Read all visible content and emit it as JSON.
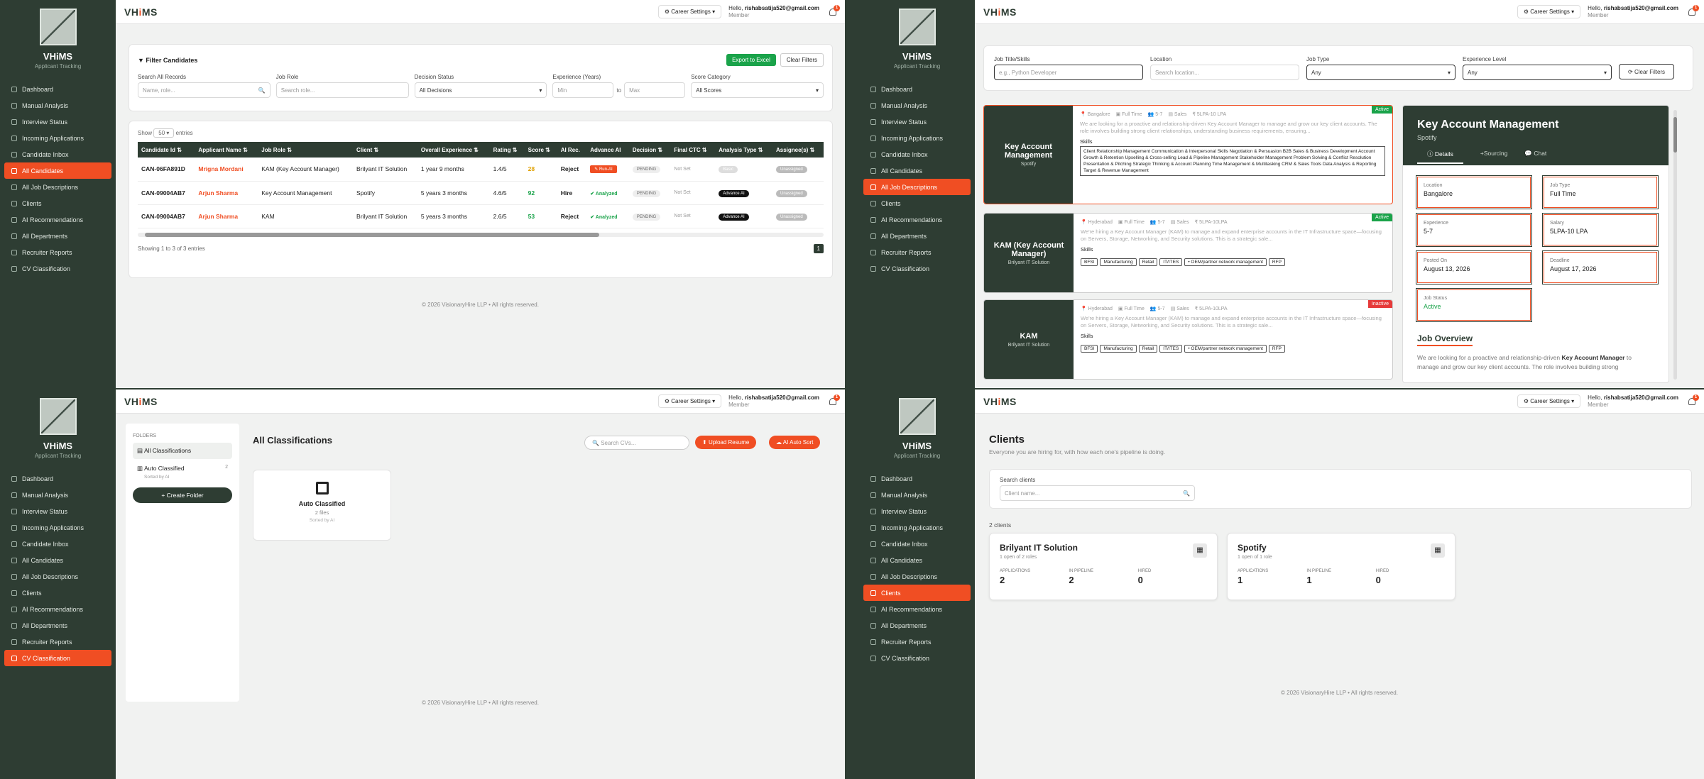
{
  "app": {
    "name": "VHiMS",
    "logo_prefix": "VH",
    "logo_accent": "i",
    "logo_suffix": "MS",
    "tagline": "Applicant Tracking",
    "career_settings": "Career Settings",
    "hello": "Hello,",
    "email": "rishabsatija520@gmail.com",
    "role": "Member",
    "notif_count": "1",
    "footer": "© 2026 VisionaryHire LLP • All rights reserved."
  },
  "nav": [
    "Dashboard",
    "Manual Analysis",
    "Interview Status",
    "Incoming Applications",
    "Candidate Inbox",
    "All Candidates",
    "All Job Descriptions",
    "Clients",
    "AI Recommendations",
    "All Departments",
    "Recruiter Reports",
    "CV Classification"
  ],
  "q1": {
    "filter_title": "Filter Candidates",
    "export": "Export to Excel",
    "clear": "Clear Filters",
    "labels": [
      "Search All Records",
      "Job Role",
      "Decision Status",
      "Experience (Years)",
      "Score Category"
    ],
    "ph": [
      "Name, role...",
      "Search role...",
      "All Decisions",
      "Min",
      "to",
      "Max",
      "All Scores"
    ],
    "show": "Show",
    "entries_val": "50",
    "entries": "entries",
    "headers": [
      "Candidate Id",
      "Applicant Name",
      "Job Role",
      "Client",
      "Overall Experience",
      "Rating",
      "Score",
      "AI Rec.",
      "Advance AI",
      "Decision",
      "Final CTC",
      "Analysis Type",
      "Assignee(s)"
    ],
    "rows": [
      [
        "CAN-06FA891D",
        "Mrigna Mordani",
        "KAM (Key Account Manager)",
        "Brilyant IT Solution",
        "1 year 9 months",
        "1.4/5",
        "28",
        "Reject",
        "Run-AI",
        "PENDING",
        "Not Set",
        "Basic",
        "Unassigned"
      ],
      [
        "CAN-09004AB7",
        "Arjun Sharma",
        "Key Account Management",
        "Spotify",
        "5 years 3 months",
        "4.6/5",
        "92",
        "Hire",
        "Analyzed",
        "PENDING",
        "Not Set",
        "Advance AI",
        "Unassigned"
      ],
      [
        "CAN-09004AB7",
        "Arjun Sharma",
        "KAM",
        "Brilyant IT Solution",
        "5 years 3 months",
        "2.6/5",
        "53",
        "Reject",
        "Analyzed",
        "PENDING",
        "Not Set",
        "Advance AI",
        "Unassigned"
      ]
    ],
    "showing": "Showing 1 to 3 of 3 entries",
    "page": "1"
  },
  "q2": {
    "labels": [
      "Job Title/Skills",
      "Location",
      "Job Type",
      "Experience Level"
    ],
    "ph": [
      "e.g., Python Developer",
      "Search location...",
      "Any",
      "Any"
    ],
    "clear": "Clear Filters",
    "jobs": [
      {
        "title": "Key Account Management",
        "client": "Spotify",
        "status": "Active",
        "loc": "Bangalore",
        "type": "Full Time",
        "exp": "5-7",
        "dept": "Sales",
        "sal": "5LPA-10 LPA",
        "desc": "We are looking for a proactive and relationship-driven&nbsp;Key Account Manager to manage and grow our key client accounts. The role involves building strong client relationships, understanding business requirements, ensuring...",
        "skills_label": "Skills",
        "skills": [
          "Client Relationship Management Communication &amp; Interpersonal Skills Negotiation &amp; Persuasion B2B Sales &amp; Business Development Account Growth &amp; Retention Upselling &amp; Cross-selling Lead &amp; Pipeline Management Stakeholder Management Problem Solving &amp; Conflict Resolution Presentation &amp; Pitching Strategic Thinking &amp; Account Planning Time Management &amp; Multitasking CRM &amp; Sales Tools Data Analysis &amp; Reporting Target &amp; Revenue Management"
        ]
      },
      {
        "title": "KAM (Key Account Manager)",
        "client": "Brilyant IT Solution",
        "status": "Active",
        "loc": "Hyderabad",
        "type": "Full Time",
        "exp": "5-7",
        "dept": "Sales",
        "sal": "5LPA-10LPA",
        "desc": "We're hiring a&nbsp;Key Account Manager (KAM)&nbsp;to manage and expand enterprise accounts in the&nbsp;IT Infrastructure space—focusing on&nbsp;Servers, Storage, Networking, and Security solutions. This is a strategic sale...",
        "skills_label": "Skills",
        "skills": [
          "BFSI",
          "Manufacturing",
          "Retail",
          "IT/ITES",
          "• OEM/partner network management",
          "RFP"
        ]
      },
      {
        "title": "KAM",
        "client": "Brilyant IT Solution",
        "status": "Inactive",
        "loc": "Hyderabad",
        "type": "Full Time",
        "exp": "5-7",
        "dept": "Sales",
        "sal": "5LPA-10LPA",
        "desc": "We're hiring a&nbsp;Key Account Manager (KAM)&nbsp;to manage and expand enterprise accounts in the&nbsp;IT Infrastructure space—focusing on&nbsp;Servers, Storage, Networking, and Security solutions. This is a strategic sale...",
        "skills_label": "Skills",
        "skills": [
          "BFSI",
          "Manufacturing",
          "Retail",
          "IT/ITES",
          "• OEM/partner network management",
          "RFP"
        ]
      }
    ],
    "detail": {
      "title": "Key Account Management",
      "client": "Spotify",
      "tabs": [
        "Details",
        "+Sourcing",
        "Chat"
      ],
      "fields": [
        [
          "Location",
          "Bangalore"
        ],
        [
          "Job Type",
          "Full Time"
        ],
        [
          "Experience",
          "5-7"
        ],
        [
          "Salary",
          "5LPA-10 LPA"
        ],
        [
          "Posted On",
          "August 13, 2026"
        ],
        [
          "Deadline",
          "August 17, 2026"
        ],
        [
          "Job Status",
          "Active"
        ]
      ],
      "overview": "Job Overview",
      "ov_text_1": "We are looking for a proactive and relationship-driven",
      "ov_bold": "Key Account Manager",
      "ov_text_2": "to manage and grow our key client accounts. The role involves building strong"
    }
  },
  "q3": {
    "folders": "FOLDERS",
    "all": "All Classifications",
    "auto": "Auto Classified",
    "auto_count": "2",
    "sorted": "Sorted by AI",
    "create": "+ Create Folder",
    "title": "All Classifications",
    "search": "Search CVs...",
    "upload": "Upload Resume",
    "aisort": "AI Auto Sort",
    "card_title": "Auto Classified",
    "card_files": "2 files",
    "card_sorted": "Sorted by AI"
  },
  "q4": {
    "title": "Clients",
    "sub": "Everyone you are hiring for, with how each one's pipeline is doing.",
    "search_label": "Search clients",
    "search_ph": "Client name...",
    "count": "2 clients",
    "clients": [
      {
        "name": "Brilyant IT Solution",
        "roles": "1 open of 2 roles",
        "app": "2",
        "pipe": "2",
        "hired": "0"
      },
      {
        "name": "Spotify",
        "roles": "1 open of 1 role",
        "app": "1",
        "pipe": "1",
        "hired": "0"
      }
    ],
    "stat_labels": [
      "APPLICATIONS",
      "IN PIPELINE",
      "HIRED"
    ]
  },
  "colors": {
    "accent": "#f04e23",
    "sidebar": "#2e3d33",
    "green": "#1aa34a"
  }
}
